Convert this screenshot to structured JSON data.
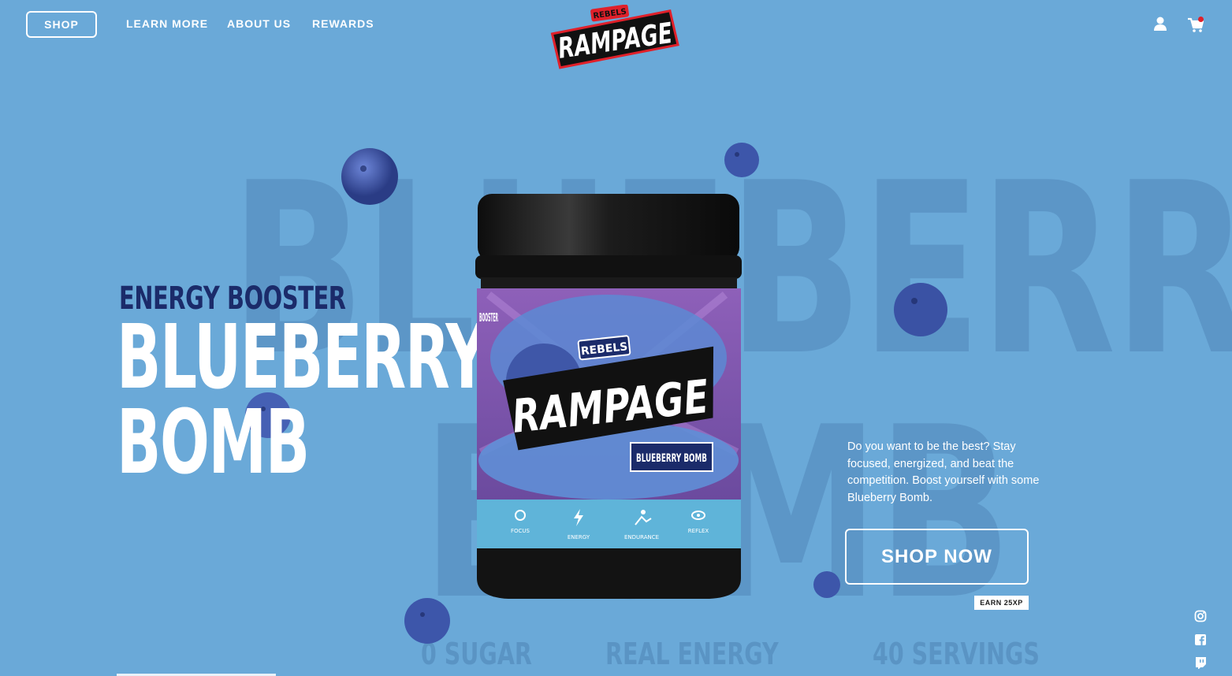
{
  "nav": {
    "shop": "SHOP",
    "links": [
      "LEARN MORE",
      "ABOUT US",
      "REWARDS"
    ]
  },
  "logo": {
    "top_text": "REBELS",
    "main_text": "RAMPAGE"
  },
  "background": {
    "word_1": "BLUEBERRY",
    "word_2": "BOMB"
  },
  "hero": {
    "subtitle": "ENERGY BOOSTER",
    "title_line_1": "BLUEBERRY",
    "title_line_2": "BOMB"
  },
  "stats": [
    "0 SUGAR",
    "REAL ENERGY",
    "40 SERVINGS"
  ],
  "product": {
    "brand_top": "REBELS",
    "brand": "RAMPAGE",
    "flavor": "BLUEBERRY BOMB",
    "side_text": "BOOSTER",
    "features": [
      "FOCUS",
      "ENERGY",
      "ENDURANCE",
      "REFLEX"
    ]
  },
  "description": "Do you want to be the best? Stay focused, energized, and beat the competition. Boost yourself with some Blueberry Bomb.",
  "cta": {
    "label": "SHOP NOW",
    "badge": "EARN 25XP"
  },
  "icons": {
    "account": "user-icon",
    "cart": "cart-icon",
    "social": [
      "instagram-icon",
      "facebook-icon",
      "twitch-icon"
    ]
  },
  "colors": {
    "background": "#6aa9d8",
    "navy": "#1b2b6a",
    "accent_red": "#e0202a",
    "purple": "#8b5fb5",
    "jar": "#141414"
  }
}
